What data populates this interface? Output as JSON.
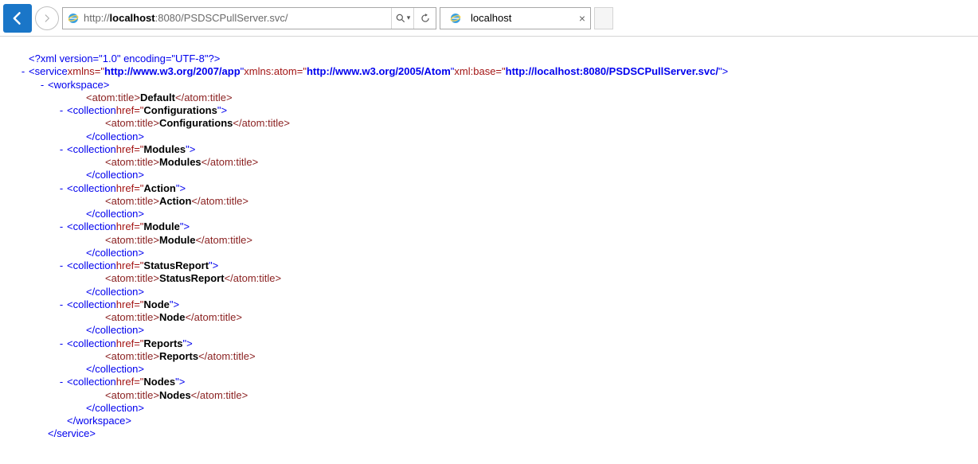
{
  "nav": {
    "url_prefix": "http://",
    "url_host": "localhost",
    "url_port_path": ":8080/PSDSCPullServer.svc/"
  },
  "tab": {
    "title": "localhost"
  },
  "xml": {
    "declaration": "<?xml version=\"1.0\" encoding=\"UTF-8\"?>",
    "service_open_a": "<service",
    "service_xmlns_label": "xmlns=\"",
    "service_xmlns": "http://www.w3.org/2007/app",
    "service_xmlns_atom_label": "xmlns:atom=\"",
    "service_xmlns_atom": "http://www.w3.org/2005/Atom",
    "service_xmlbase_label": "xml:base=\"",
    "service_xmlbase": "http://localhost:8080/PSDSCPullServer.svc/",
    "close_gt": ">",
    "workspace_open": "<workspace>",
    "workspace_close": "</workspace>",
    "service_close": "</service>",
    "atom_title_open": "<atom:title>",
    "atom_title_close": "</atom:title>",
    "collection_open_prefix": "<collection",
    "collection_href_label": "href=\"",
    "collection_close": "</collection>",
    "quote": "\"",
    "default_title": "Default",
    "collections": [
      {
        "href": "Configurations",
        "title": "Configurations"
      },
      {
        "href": "Modules",
        "title": "Modules"
      },
      {
        "href": "Action",
        "title": "Action"
      },
      {
        "href": "Module",
        "title": "Module"
      },
      {
        "href": "StatusReport",
        "title": "StatusReport"
      },
      {
        "href": "Node",
        "title": "Node"
      },
      {
        "href": "Reports",
        "title": "Reports"
      },
      {
        "href": "Nodes",
        "title": "Nodes"
      }
    ]
  }
}
